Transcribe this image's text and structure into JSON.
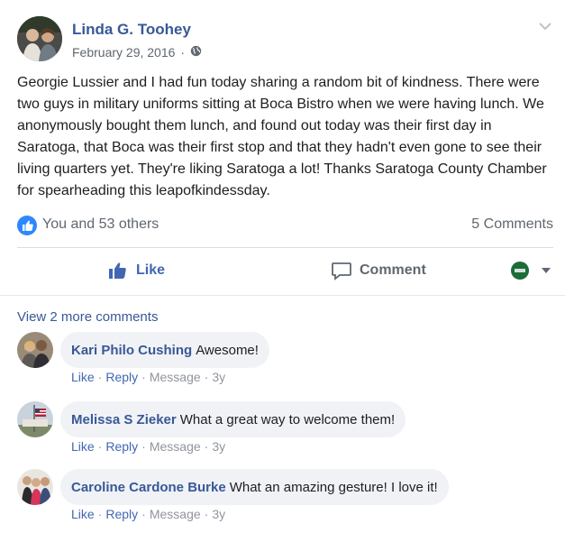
{
  "post": {
    "author": "Linda G. Toohey",
    "date": "February 29, 2016",
    "audience_icon": "globe-icon",
    "text": "Georgie Lussier and I had fun today sharing a random bit of kindness. There were two guys in military uniforms sitting at Boca Bistro when we were having lunch. We anonymously bought them lunch, and found out today was their first day in Saratoga, that Boca was their first stop and that they hadn't even gone to see their living quarters yet. They're liking Saratoga a lot! Thanks Saratoga County Chamber for spearheading this leapofkindessday.",
    "reactions_text": "You and 53 others",
    "comments_count": "5 Comments"
  },
  "actions": {
    "like": "Like",
    "comment": "Comment"
  },
  "comments_section": {
    "view_more": "View 2 more comments",
    "items": [
      {
        "name": "Kari Philo Cushing",
        "text": "Awesome!",
        "like": "Like",
        "reply": "Reply",
        "message": "Message",
        "age": "3y"
      },
      {
        "name": "Melissa S Zieker",
        "text": "What a great way to welcome them!",
        "like": "Like",
        "reply": "Reply",
        "message": "Message",
        "age": "3y"
      },
      {
        "name": "Caroline Cardone Burke",
        "text": "What an amazing gesture! I love it!",
        "like": "Like",
        "reply": "Reply",
        "message": "Message",
        "age": "3y"
      }
    ]
  },
  "colors": {
    "link_blue": "#385898",
    "like_blue": "#2d88ff",
    "muted": "#606770",
    "bubble_bg": "#f0f2f5"
  }
}
